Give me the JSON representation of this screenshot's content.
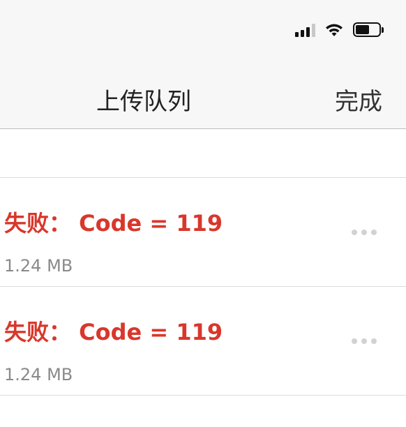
{
  "header": {
    "title": "上传队列",
    "done_label": "完成"
  },
  "status_bar": {
    "icons": [
      "signal-icon",
      "wifi-icon",
      "battery-icon"
    ]
  },
  "uploads": [
    {
      "status": "失败： Code = 119",
      "size": "1.24 MB"
    },
    {
      "status": "失败： Code = 119",
      "size": "1.24 MB"
    }
  ],
  "colors": {
    "error": "#d9372b",
    "secondary_text": "#8a8a8a",
    "header_bg": "#f7f7f7"
  }
}
